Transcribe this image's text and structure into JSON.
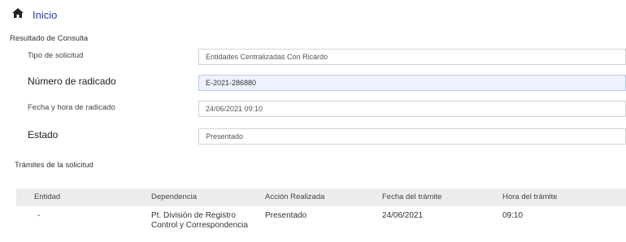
{
  "nav": {
    "home_icon": "home-icon",
    "home_label": "Inicio"
  },
  "consult_title": "Resultado de Consulta",
  "fields": [
    {
      "label": "Tipo de solicitud",
      "value": "Entidades Centralizadas Con Ricardo"
    },
    {
      "label": "Número de radicado",
      "value": "E-2021-286880"
    },
    {
      "label": "Fecha y hora de radicado",
      "value": "24/06/2021 09:10"
    },
    {
      "label": "Estado",
      "value": "Presentado"
    }
  ],
  "tramites_title": "Trámites de la solicitud",
  "table": {
    "headers": [
      "Entidad",
      "Dependencia",
      "Acción Realizada",
      "Fecha del trámite",
      "Hora del trámite"
    ],
    "rows": [
      [
        "-",
        "Pt. División de Registro Control y Correspondencia",
        "Presentado",
        "24/06/2021",
        "09:10"
      ]
    ]
  },
  "colors": {
    "link": "#2b3fa6",
    "header_bg": "#ececec",
    "active_field_bg": "#eef3ff"
  }
}
